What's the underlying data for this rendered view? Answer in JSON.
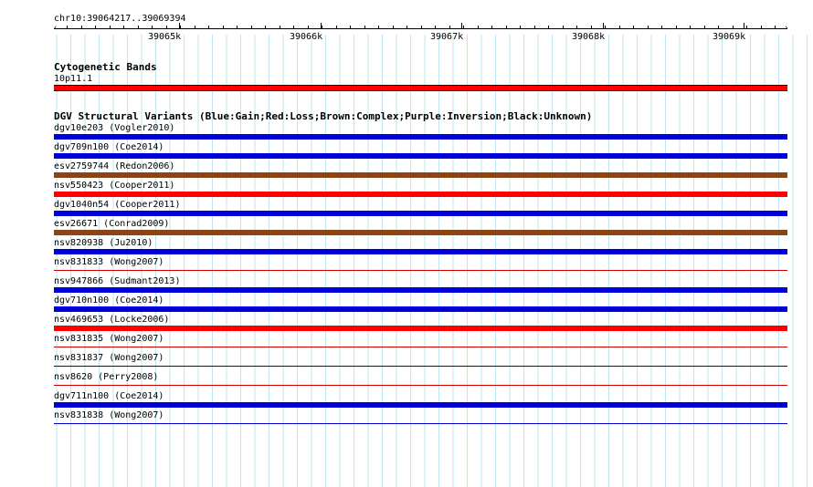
{
  "location": "chr10:39064217..39069394",
  "ruler": {
    "ticks": [
      "39065k",
      "39066k",
      "39067k",
      "39068k",
      "39069k"
    ]
  },
  "cytoband_track": {
    "title": "Cytogenetic Bands",
    "band_label": "10p11.1",
    "color": "#ff0000"
  },
  "dgv_track": {
    "title": "DGV Structural Variants (Blue:Gain;Red:Loss;Brown:Complex;Purple:Inversion;Black:Unknown)",
    "legend_colors": {
      "gain": "#0000dd",
      "loss": "#ff0000",
      "complex": "#8b4513"
    },
    "features": [
      {
        "label": "dgv10e203 (Vogler2010)",
        "type": "gain"
      },
      {
        "label": "dgv709n100 (Coe2014)",
        "type": "gain"
      },
      {
        "label": "esv2759744 (Redon2006)",
        "type": "complex"
      },
      {
        "label": "nsv550423 (Cooper2011)",
        "type": "loss"
      },
      {
        "label": "dgv1040n54 (Cooper2011)",
        "type": "gain"
      },
      {
        "label": "esv26671 (Conrad2009)",
        "type": "complex"
      },
      {
        "label": "nsv820938 (Ju2010)",
        "type": "gain"
      },
      {
        "label": "nsv831833 (Wong2007)",
        "type": "loss-thin"
      },
      {
        "label": "nsv947866 (Sudmant2013)",
        "type": "gain"
      },
      {
        "label": "dgv710n100 (Coe2014)",
        "type": "gain"
      },
      {
        "label": "nsv469653 (Locke2006)",
        "type": "loss"
      },
      {
        "label": "nsv831835 (Wong2007)",
        "type": "loss-thin"
      },
      {
        "label": "nsv831837 (Wong2007)",
        "type": "gain-thin"
      },
      {
        "label": "nsv8620 (Perry2008)",
        "type": "loss-thin"
      },
      {
        "label": "dgv711n100 (Coe2014)",
        "type": "gain"
      },
      {
        "label": "nsv831838 (Wong2007)",
        "type": "gain-thin"
      }
    ]
  }
}
